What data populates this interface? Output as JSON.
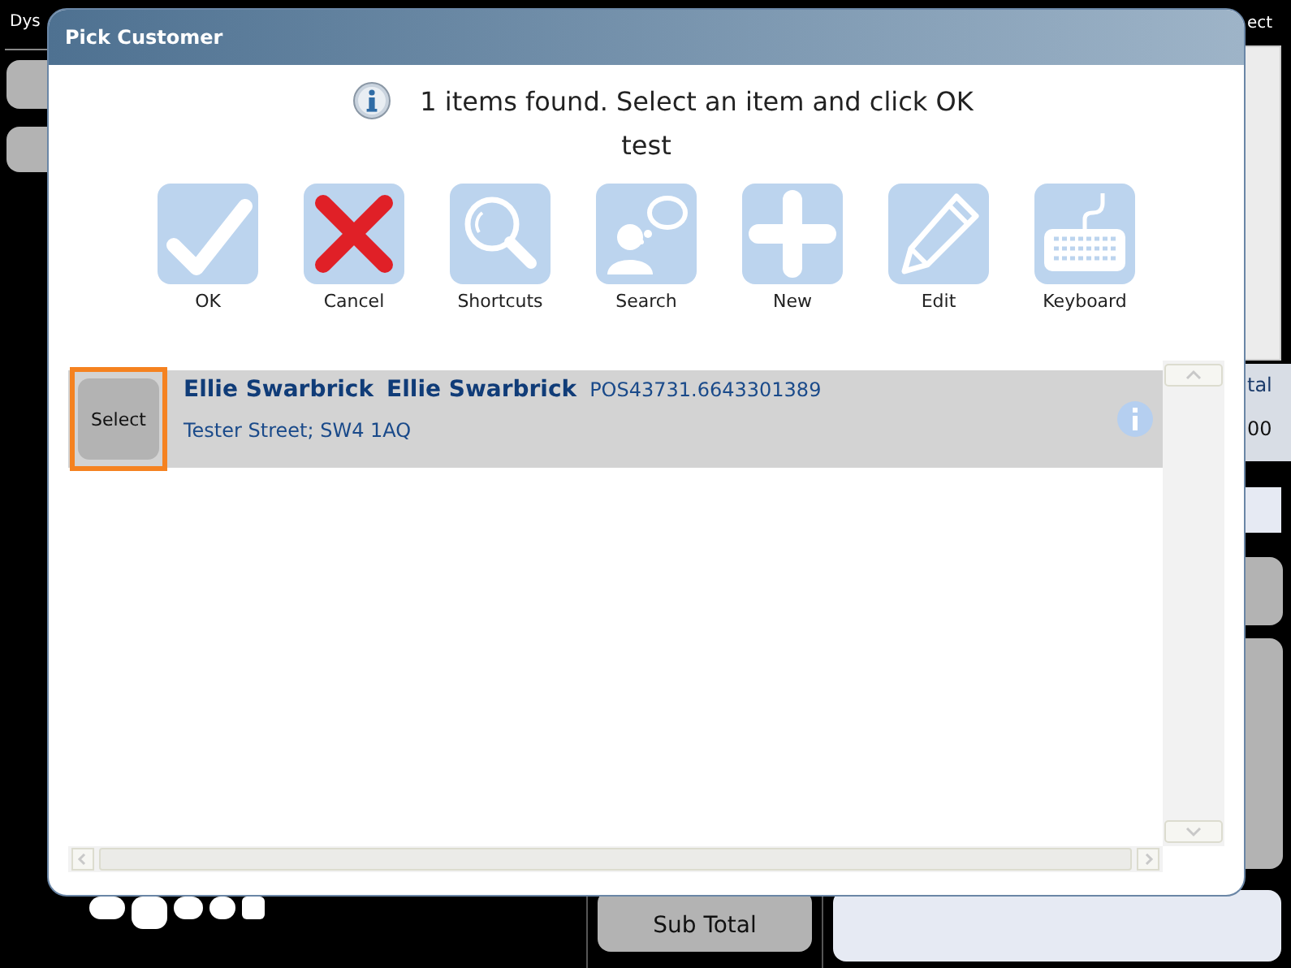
{
  "background": {
    "header_left": "Dys",
    "header_right": "ect",
    "total_label": "tal",
    "total_value": "00",
    "subtotal_button": "Sub Total"
  },
  "dialog": {
    "title": "Pick Customer",
    "message": "1 items found. Select an item and click OK",
    "query": "test",
    "toolbar": [
      {
        "kind": "ok",
        "label": "OK"
      },
      {
        "kind": "cancel",
        "label": "Cancel"
      },
      {
        "kind": "shortcuts",
        "label": "Shortcuts"
      },
      {
        "kind": "search",
        "label": "Search"
      },
      {
        "kind": "new",
        "label": "New"
      },
      {
        "kind": "edit",
        "label": "Edit"
      },
      {
        "kind": "keyboard",
        "label": "Keyboard"
      }
    ],
    "results": [
      {
        "names": [
          "Ellie Swarbrick",
          "Ellie Swarbrick"
        ],
        "code": "POS43731.6643301389",
        "address": "Tester Street; SW4 1AQ",
        "select_label": "Select",
        "selected": true
      }
    ]
  }
}
